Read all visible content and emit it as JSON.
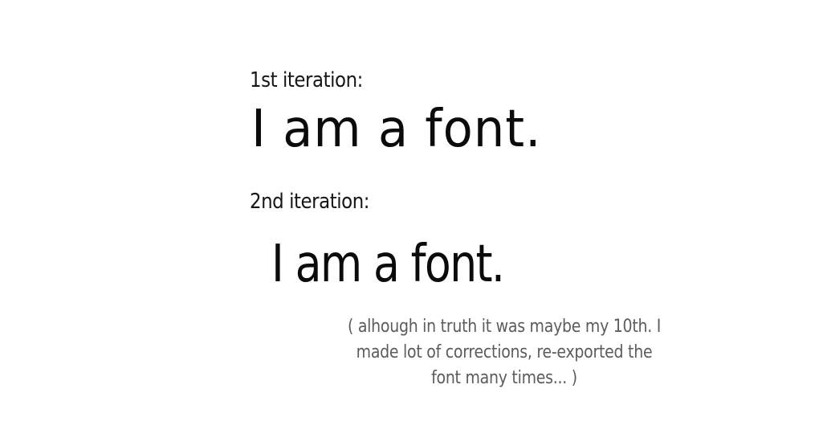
{
  "first_iteration": {
    "label": "1st iteration:",
    "sample_text": "I am a font."
  },
  "second_iteration": {
    "label": "2nd iteration:",
    "sample_text": "I am a font."
  },
  "note": {
    "lines": [
      "( alhough in truth it was maybe my 10th. I",
      "made lot of corrections, re-exported the",
      "font many times... )"
    ]
  },
  "colors": {
    "background": "#ffffff",
    "text": "#0b0b0b",
    "note_text": "#5c5c5c"
  }
}
